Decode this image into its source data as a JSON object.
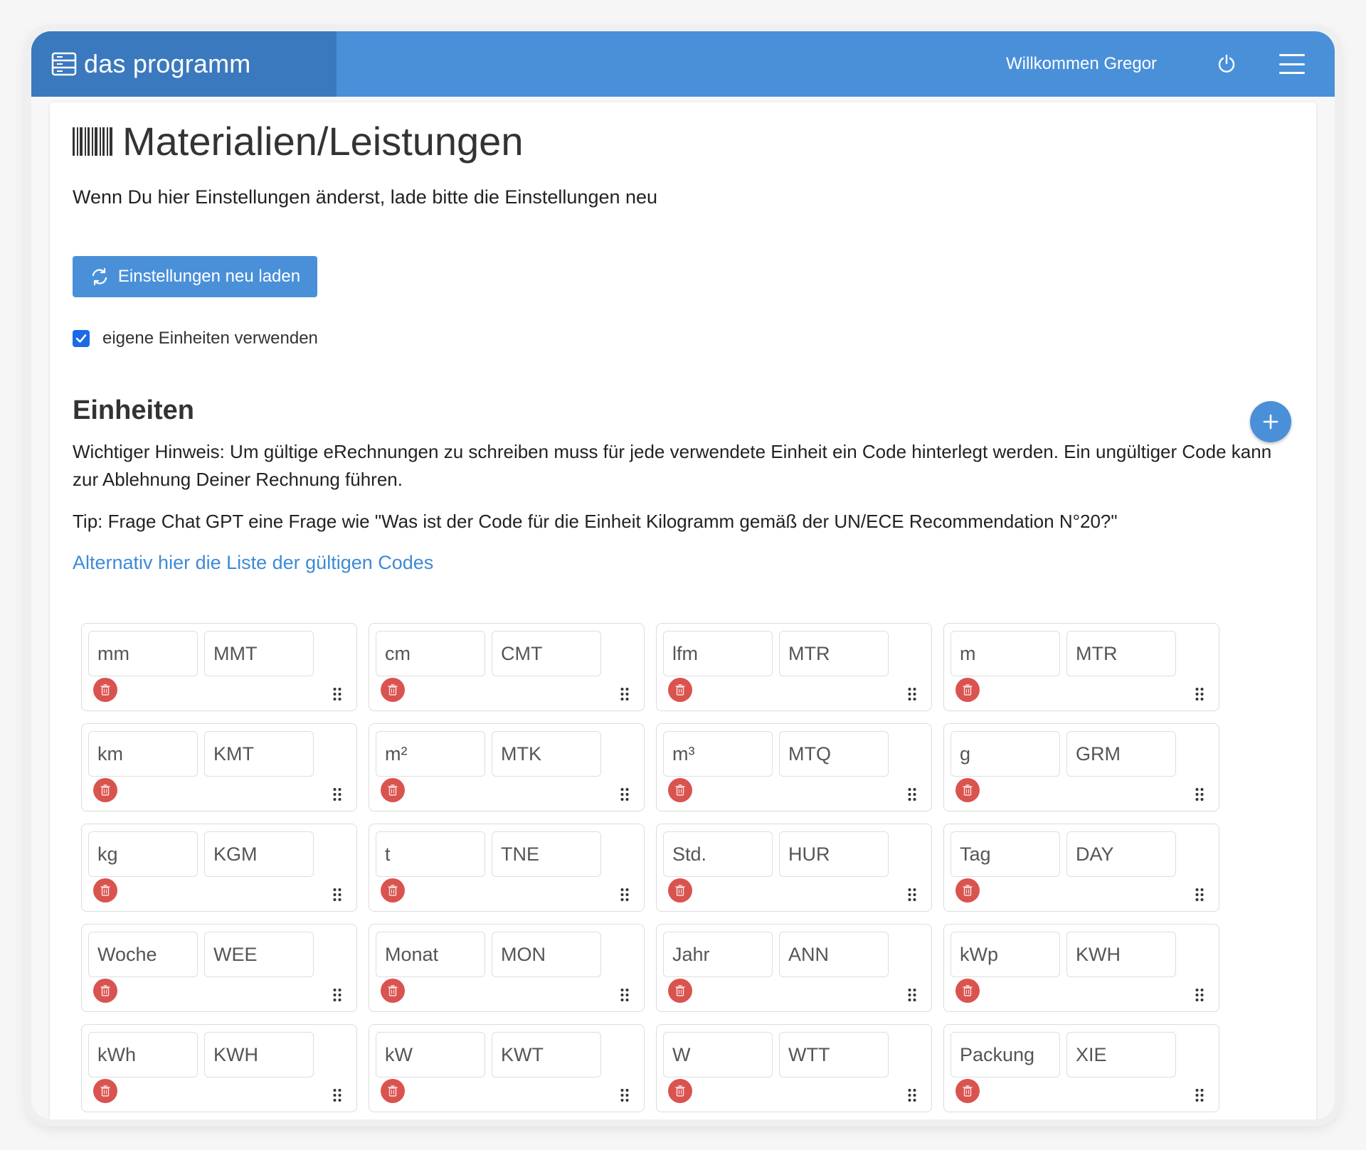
{
  "header": {
    "brand": "das programm",
    "welcome": "Willkommen Gregor"
  },
  "page": {
    "title": "Materialien/Leistungen",
    "hint": "Wenn Du hier Einstellungen änderst, lade bitte die Einstellungen neu",
    "reload_button": "Einstellungen neu laden",
    "custom_units_checkbox": {
      "label": "eigene Einheiten verwenden",
      "checked": true
    }
  },
  "units_section": {
    "title": "Einheiten",
    "notice": "Wichtiger Hinweis: Um gültige eRechnungen zu schreiben muss für jede verwendete Einheit ein Code hinterlegt werden. Ein ungültiger Code kann zur Ablehnung Deiner Rechnung führen.",
    "tip": "Tip: Frage Chat GPT eine Frage wie \"Was ist der Code für die Einheit Kilogramm gemäß der UN/ECE Recommendation N°20?\"",
    "codes_link": "Alternativ hier die Liste der gültigen Codes",
    "units": [
      {
        "name": "mm",
        "code": "MMT"
      },
      {
        "name": "cm",
        "code": "CMT"
      },
      {
        "name": "lfm",
        "code": "MTR"
      },
      {
        "name": "m",
        "code": "MTR"
      },
      {
        "name": "km",
        "code": "KMT"
      },
      {
        "name": "m²",
        "code": "MTK"
      },
      {
        "name": "m³",
        "code": "MTQ"
      },
      {
        "name": "g",
        "code": "GRM"
      },
      {
        "name": "kg",
        "code": "KGM"
      },
      {
        "name": "t",
        "code": "TNE"
      },
      {
        "name": "Std.",
        "code": "HUR"
      },
      {
        "name": "Tag",
        "code": "DAY"
      },
      {
        "name": "Woche",
        "code": "WEE"
      },
      {
        "name": "Monat",
        "code": "MON"
      },
      {
        "name": "Jahr",
        "code": "ANN"
      },
      {
        "name": "kWp",
        "code": "KWH"
      },
      {
        "name": "kWh",
        "code": "KWH"
      },
      {
        "name": "kW",
        "code": "KWT"
      },
      {
        "name": "W",
        "code": "WTT"
      },
      {
        "name": "Packung",
        "code": "XIE"
      }
    ]
  },
  "icons": {
    "brand": "server-icon",
    "page_title": "barcode-icon",
    "reload": "refresh-icon",
    "power": "power-icon",
    "menu": "hamburger-icon",
    "add": "plus-icon",
    "delete": "trash-icon",
    "drag": "drag-handle-icon"
  },
  "colors": {
    "navbar": "#4a90d9",
    "brand_bg": "#3a79bd",
    "primary": "#4a90d9",
    "link": "#3d8ad8",
    "danger": "#d9534f",
    "checkbox": "#1b6ae8"
  }
}
